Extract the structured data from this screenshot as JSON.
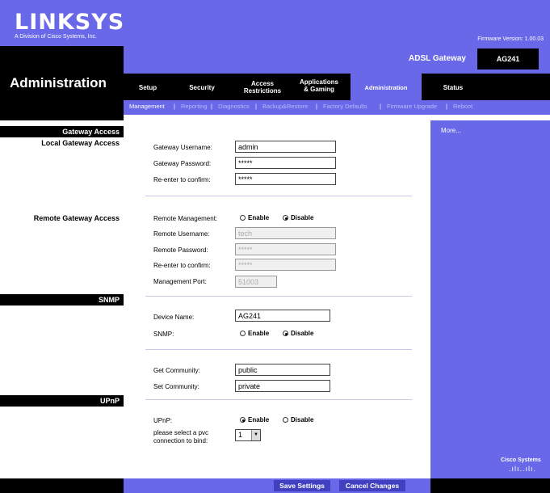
{
  "header": {
    "brand": "LINKSYS",
    "brand_sub": "A Division of Cisco Systems, Inc.",
    "firmware": "Firmware Version: 1.00.03",
    "product": "ADSL Gateway",
    "model": "AG241",
    "page_title": "Administration"
  },
  "nav": {
    "tabs": [
      {
        "label": "Setup"
      },
      {
        "label": "Security"
      },
      {
        "label": "Access\nRestrictions"
      },
      {
        "label": "Applications\n& Gaming"
      },
      {
        "label": "Administration"
      },
      {
        "label": "Status"
      }
    ],
    "subtabs": [
      {
        "label": "Management"
      },
      {
        "label": "Reporting"
      },
      {
        "label": "Diagnostics"
      },
      {
        "label": "Backup&Restore"
      },
      {
        "label": "Factory Defaults"
      },
      {
        "label": "Firmware Upgrade"
      },
      {
        "label": "Reboot"
      }
    ]
  },
  "sections": {
    "gateway_access": "Gateway Access",
    "local_gateway_access": "Local Gateway Access",
    "remote_gateway_access": "Remote Gateway Access",
    "snmp": "SNMP",
    "upnp": "UPnP"
  },
  "local": {
    "username_label": "Gateway Username:",
    "username_value": "admin",
    "password_label": "Gateway Password:",
    "password_value": "*****",
    "confirm_label": "Re-enter to confirm:",
    "confirm_value": "*****"
  },
  "remote": {
    "mgmt_label": "Remote Management:",
    "enable": "Enable",
    "disable": "Disable",
    "username_label": "Remote Username:",
    "username_value": "tech",
    "password_label": "Remote Password:",
    "password_value": "*****",
    "confirm_label": "Re-enter to confirm:",
    "confirm_value": "*****",
    "port_label": "Management Port:",
    "port_value": "51003"
  },
  "snmp": {
    "device_name_label": "Device Name:",
    "device_name_value": "AG241",
    "snmp_label": "SNMP:",
    "enable": "Enable",
    "disable": "Disable",
    "get_label": "Get Community:",
    "get_value": "public",
    "set_label": "Set Community:",
    "set_value": "private"
  },
  "upnp": {
    "upnp_label": "UPnP:",
    "enable": "Enable",
    "disable": "Disable",
    "pvc_label_1": "please select a pvc",
    "pvc_label_2": "connection to bind:",
    "pvc_value": "1"
  },
  "right": {
    "more": "More...",
    "cisco": "Cisco Systems"
  },
  "footer": {
    "save": "Save Settings",
    "cancel": "Cancel Changes"
  },
  "colors": {
    "accent": "#6868e8",
    "bar": "#000000"
  }
}
